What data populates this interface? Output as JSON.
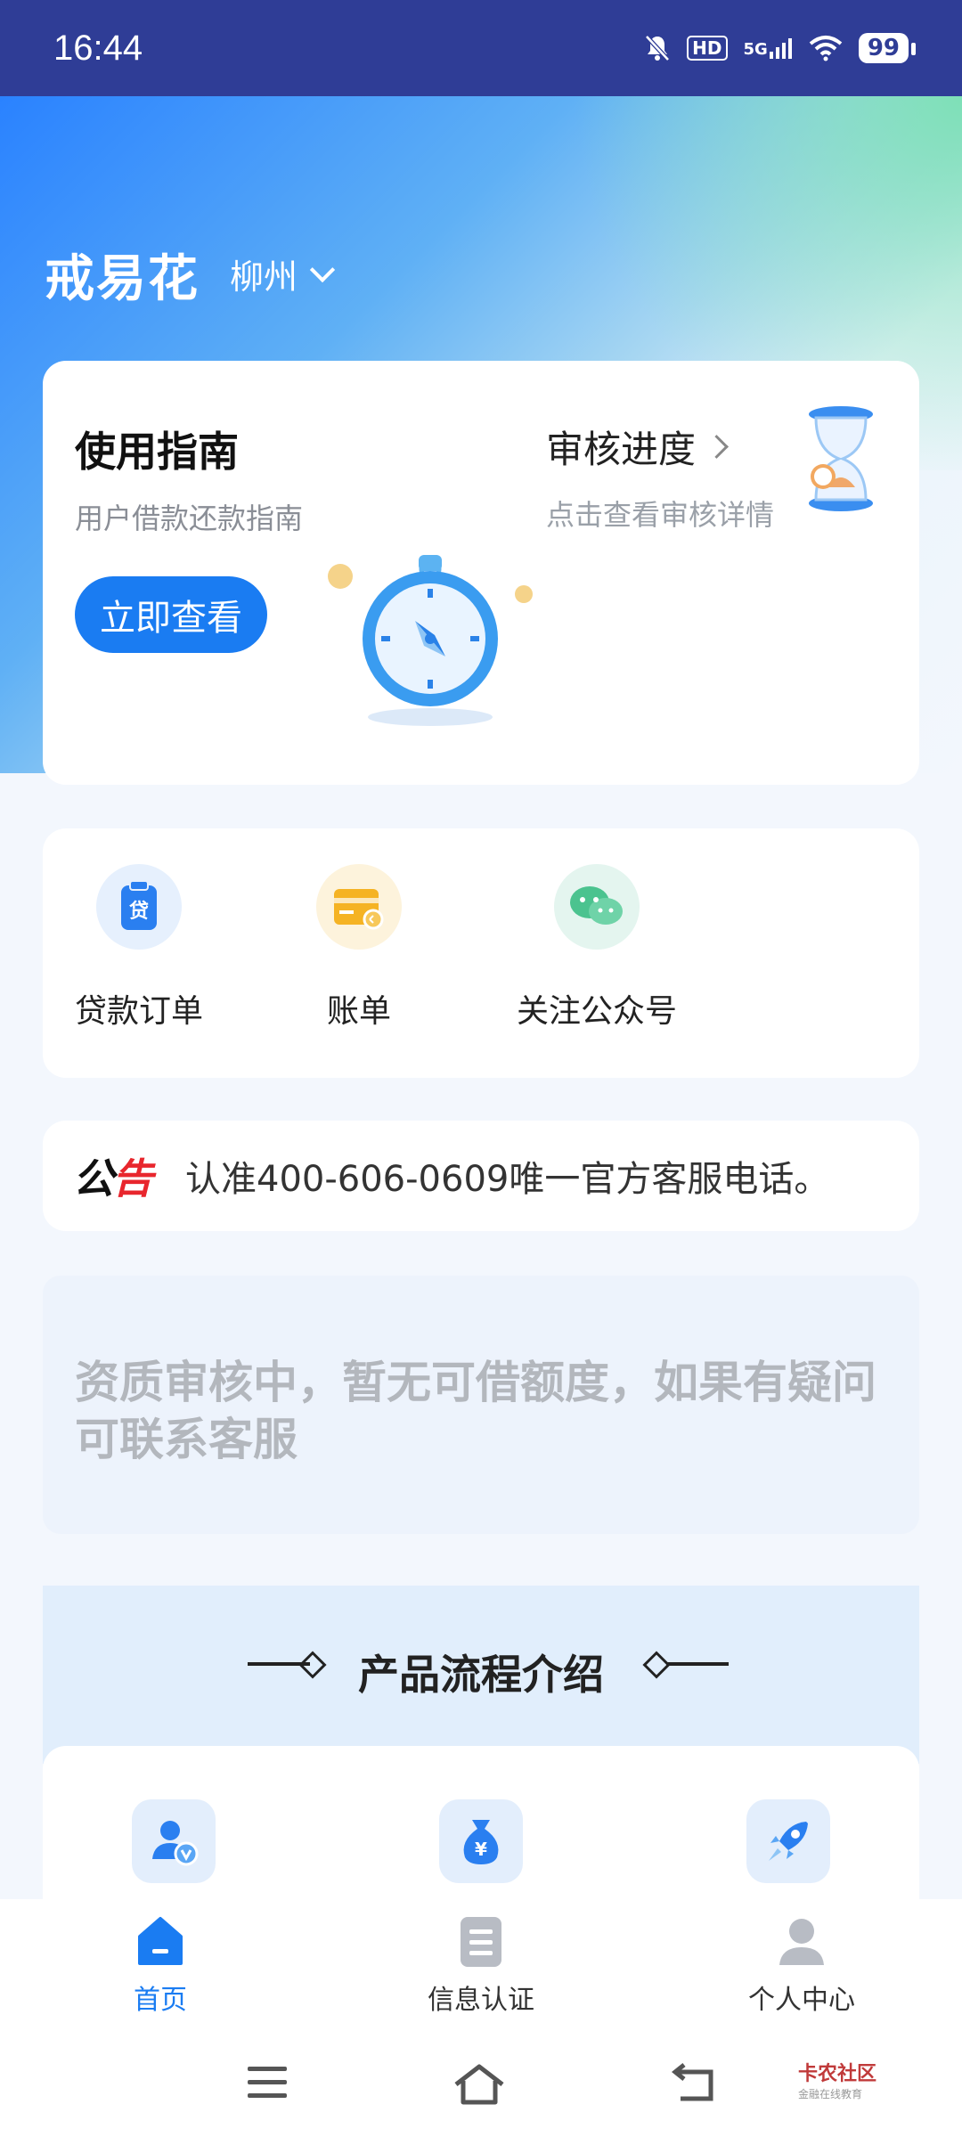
{
  "status_bar": {
    "time": "16:44",
    "network": "5G",
    "hd": "HD",
    "battery": "99"
  },
  "header": {
    "app_name": "戒易花",
    "city": "柳州"
  },
  "guide_card": {
    "title": "使用指南",
    "subtitle": "用户借款还款指南",
    "button": "立即查看",
    "progress_title": "审核进度",
    "progress_subtitle": "点击查看审核详情"
  },
  "quick_actions": [
    {
      "label": "贷款订单",
      "icon": "loan-order-icon"
    },
    {
      "label": "账单",
      "icon": "bill-icon"
    },
    {
      "label": "关注公众号",
      "icon": "wechat-icon"
    }
  ],
  "notice": {
    "tag_black": "公",
    "tag_red": "告",
    "text": "认准400-606-0609唯一官方客服电话。"
  },
  "status_message": "资质审核中，暂无可借额度，如果有疑问可联系客服",
  "process": {
    "title": "产品流程介绍"
  },
  "tabbar": [
    {
      "label": "首页",
      "icon": "home-icon",
      "active": true
    },
    {
      "label": "信息认证",
      "icon": "document-icon",
      "active": false
    },
    {
      "label": "个人中心",
      "icon": "person-icon",
      "active": false
    }
  ],
  "watermark": {
    "title": "卡农社区",
    "subtitle": "金融在线教育"
  },
  "colors": {
    "primary": "#1a7cf2",
    "status_bar": "#2f3d96",
    "notice_red": "#e8262d"
  }
}
